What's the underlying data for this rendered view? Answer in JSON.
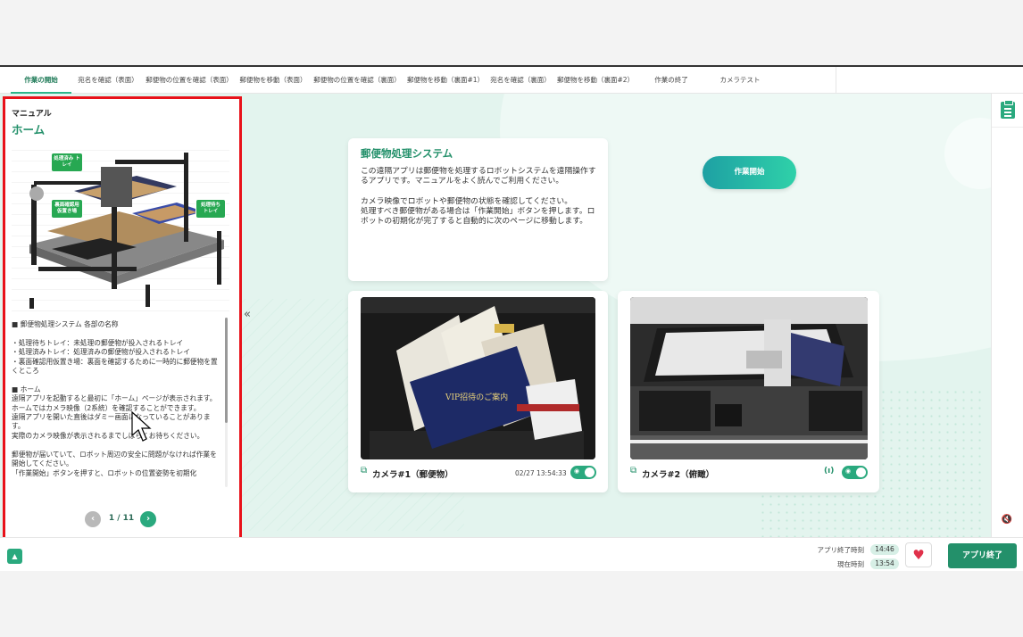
{
  "tabs": [
    {
      "label": "作業の開始",
      "active": true
    },
    {
      "label": "宛名を確認（表面）"
    },
    {
      "label": "郵便物の位置を確認（表面）"
    },
    {
      "label": "郵便物を移動（表面）"
    },
    {
      "label": "郵便物の位置を確認（裏面）"
    },
    {
      "label": "郵便物を移動（裏面#1）"
    },
    {
      "label": "宛名を確認（裏面）"
    },
    {
      "label": "郵便物を移動（裏面#2）"
    },
    {
      "label": "作業の終了"
    },
    {
      "label": "カメラテスト"
    }
  ],
  "manual": {
    "label": "マニュアル",
    "title": "ホーム",
    "figure_callouts": [
      "処理済み\nトレイ",
      "裏面確認用\n仮置き場",
      "処理待ち\nトレイ"
    ],
    "body": "■ 郵便物処理システム 各部の名称\n\n・処理待ちトレイ：未処理の郵便物が投入されるトレイ\n・処理済みトレイ：処理済みの郵便物が投入されるトレイ\n・裏面確認用仮置き場：裏面を確認するために一時的に郵便物を置くところ\n\n■ ホーム\n遠隔アプリを起動すると最初に「ホーム」ページが表示されます。\nホームではカメラ映像（2系統）を確認することができます。\n遠隔アプリを開いた直後はダミー画面になっていることがあります。\n実際のカメラ映像が表示されるまでしばらくお待ちください。\n\n郵便物が届いていて、ロボット周辺の安全に問題がなければ作業を開始してください。\n「作業開始」ボタンを押すと、ロボットの位置姿勢を初期化",
    "pager": "1 / 11"
  },
  "info": {
    "title": "郵便物処理システム",
    "text": "この遠隔アプリは郵便物を処理するロボットシステムを遠隔操作するアプリです。マニュアルをよく読んでご利用ください。\n\nカメラ映像でロボットや郵便物の状態を確認してください。\n処理すべき郵便物がある場合は「作業開始」ボタンを押します。ロボットの初期化が完了すると自動的に次のページに移動します。"
  },
  "start_button": "作業開始",
  "camera1": {
    "label": "カメラ#1（郵便物）",
    "timestamp": "02/27 13:54:33",
    "toggle_on": true
  },
  "camera2": {
    "label": "カメラ#2（俯瞰）",
    "toggle_on": true
  },
  "footer": {
    "end_time_label": "アプリ終了時刻",
    "end_time": "14:46",
    "current_time_label": "現在時刻",
    "current_time": "13:54",
    "end_button": "アプリ終了"
  },
  "colors": {
    "accent": "#2aa97e",
    "accent_dark": "#23906a",
    "highlight": "#e8121a"
  }
}
